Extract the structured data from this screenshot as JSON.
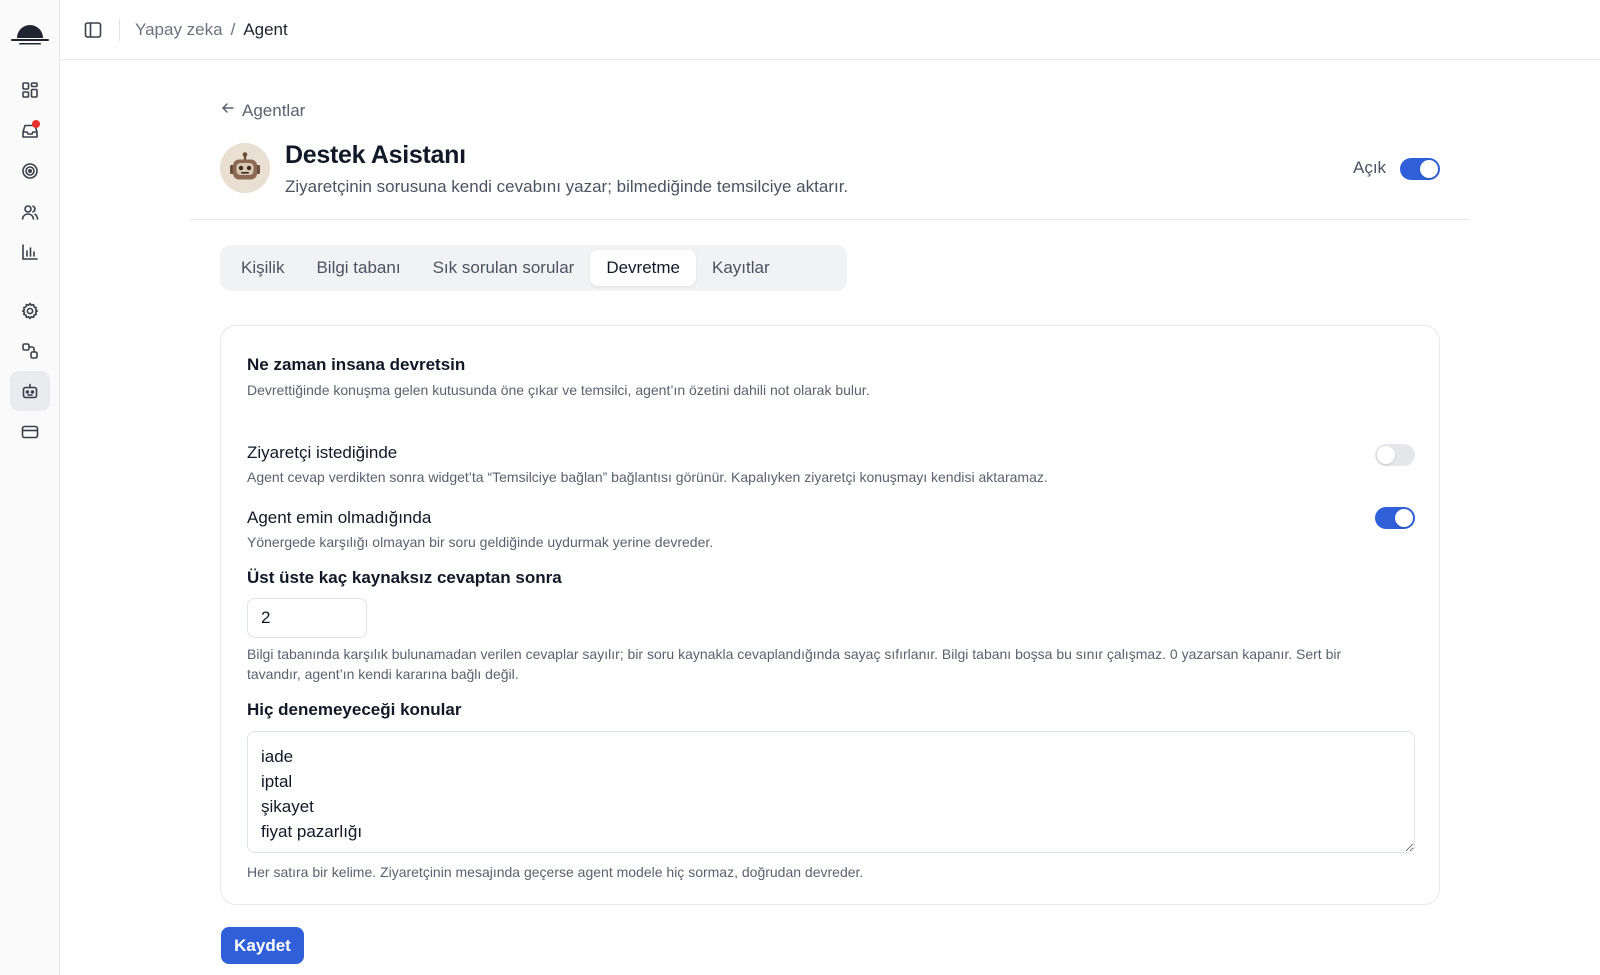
{
  "breadcrumb": {
    "parent": "Yapay zeka",
    "separator": "/",
    "current": "Agent"
  },
  "sidebar": {
    "icons": [
      "dashboard-icon",
      "inbox-icon",
      "target-icon",
      "users-icon",
      "chart-icon",
      "settings-icon",
      "integrations-icon",
      "bot-icon",
      "billing-icon"
    ],
    "active": "bot-icon"
  },
  "agent": {
    "back_label": "Agentlar",
    "name": "Destek Asistanı",
    "description": "Ziyaretçinin sorusuna kendi cevabını yazar; bilmediğinde temsilciye aktarır.",
    "status_label": "Açık",
    "enabled": true
  },
  "tabs": [
    {
      "label": "Kişilik",
      "active": false
    },
    {
      "label": "Bilgi tabanı",
      "active": false
    },
    {
      "label": "Sık sorulan sorular",
      "active": false
    },
    {
      "label": "Devretme",
      "active": true
    },
    {
      "label": "Kayıtlar",
      "active": false
    }
  ],
  "handoff": {
    "title": "Ne zaman insana devretsin",
    "description": "Devrettiğinde konuşma gelen kutusunda öne çıkar ve temsilci, agent’ın özetini dahili not olarak bulur.",
    "visitor_request": {
      "title": "Ziyaretçi istediğinde",
      "description": "Agent cevap verdikten sonra widget’ta “Temsilciye bağlan” bağlantısı görünür. Kapalıyken ziyaretçi konuşmayı kendisi aktaramaz.",
      "enabled": false
    },
    "agent_unsure": {
      "title": "Agent emin olmadığında",
      "description": "Yönergede karşılığı olmayan bir soru geldiğinde uydurmak yerine devreder.",
      "enabled": true
    },
    "unsourced_limit": {
      "label": "Üst üste kaç kaynaksız cevaptan sonra",
      "value": "2",
      "help": "Bilgi tabanında karşılık bulunamadan verilen cevaplar sayılır; bir soru kaynakla cevaplandığında sayaç sıfırlanır. Bilgi tabanı boşsa bu sınır çalışmaz. 0 yazarsan kapanır. Sert bir tavandır, agent’ın kendi kararına bağlı değil."
    },
    "forbidden_topics": {
      "label": "Hiç denemeyeceği konular",
      "value": "iade\niptal\nşikayet\nfiyat pazarlığı",
      "help": "Her satıra bir kelime. Ziyaretçinin mesajında geçerse agent modele hiç sormaz, doğrudan devreder."
    }
  },
  "save_label": "Kaydet",
  "colors": {
    "accent": "#2f5fd9",
    "notification": "#e5312c"
  }
}
